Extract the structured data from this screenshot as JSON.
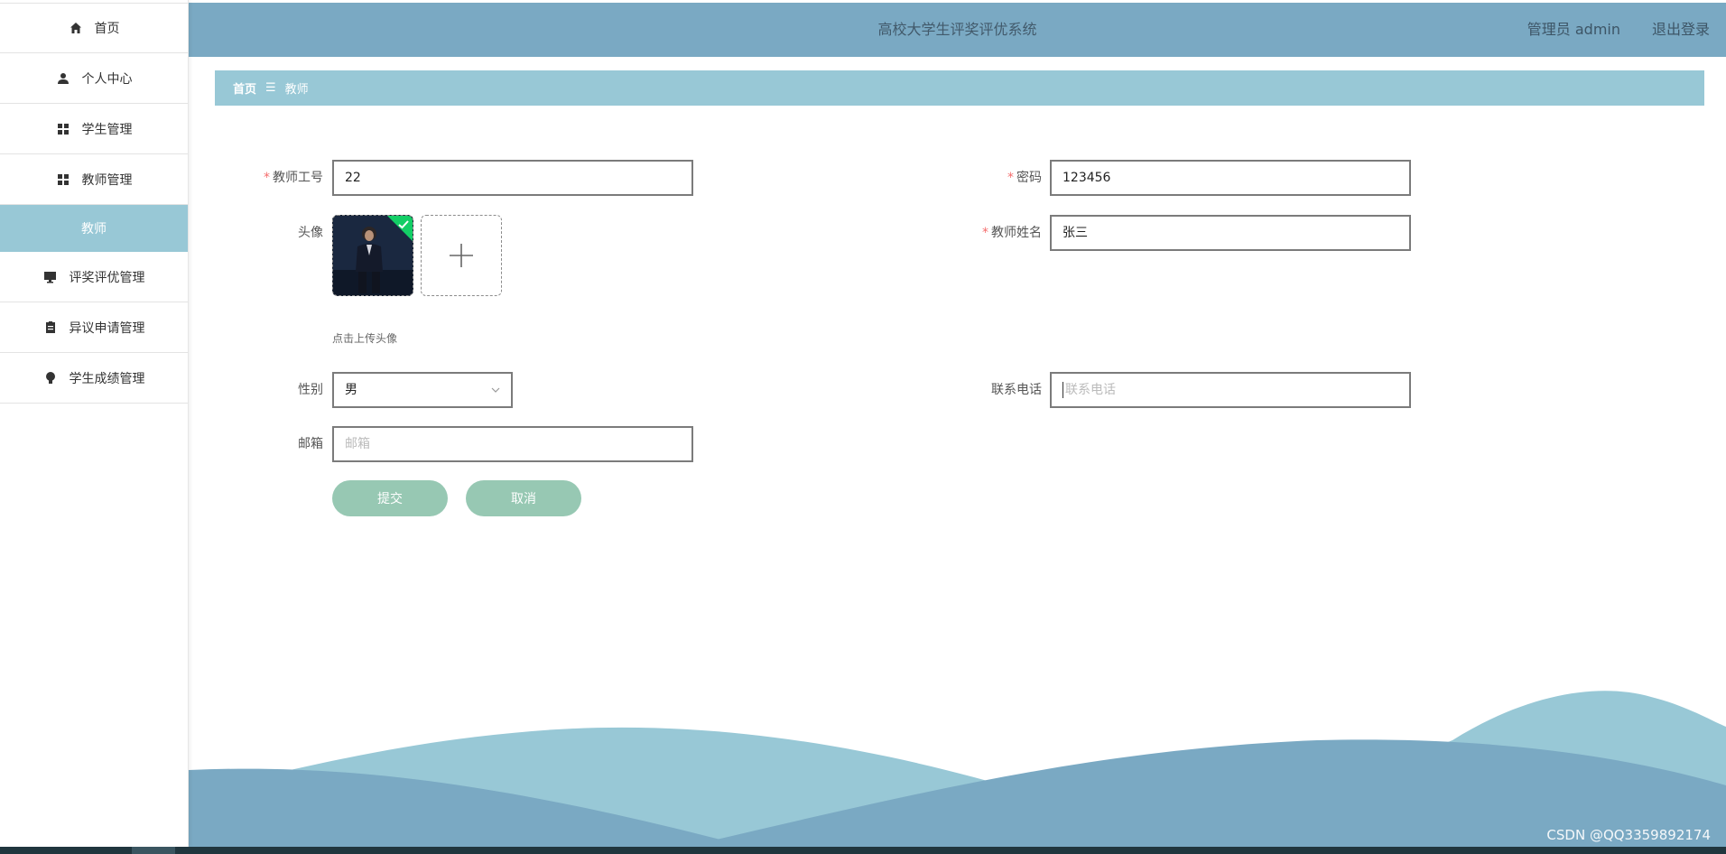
{
  "sidebar": {
    "items": [
      {
        "label": "首页",
        "icon": "home-icon"
      },
      {
        "label": "个人中心",
        "icon": "user-icon"
      },
      {
        "label": "学生管理",
        "icon": "grid-icon"
      },
      {
        "label": "教师管理",
        "icon": "grid-icon"
      },
      {
        "label": "教师",
        "icon": ""
      },
      {
        "label": "评奖评优管理",
        "icon": "monitor-icon"
      },
      {
        "label": "异议申请管理",
        "icon": "clipboard-icon"
      },
      {
        "label": "学生成绩管理",
        "icon": "bulb-icon"
      }
    ]
  },
  "header": {
    "title": "高校大学生评奖评优系统",
    "user": "管理员 admin",
    "logout": "退出登录"
  },
  "breadcrumb": {
    "home": "首页",
    "separator": "☰",
    "current": "教师"
  },
  "form": {
    "teacher_id": {
      "label": "教师工号",
      "required": "*",
      "value": "22"
    },
    "password": {
      "label": "密码",
      "required": "*",
      "value": "123456"
    },
    "avatar": {
      "label": "头像",
      "tip": "点击上传头像"
    },
    "teacher_name": {
      "label": "教师姓名",
      "required": "*",
      "value": "张三"
    },
    "gender": {
      "label": "性别",
      "value": "男"
    },
    "phone": {
      "label": "联系电话",
      "placeholder": "联系电话"
    },
    "email": {
      "label": "邮箱",
      "placeholder": "邮箱"
    },
    "submit": "提交",
    "cancel": "取消"
  },
  "watermark": "CSDN @QQ3359892174",
  "colors": {
    "header": "#7aa9c3",
    "breadcrumb": "#98c8d6",
    "active_menu": "#98c8d6",
    "button": "#97c8b3",
    "required": "#f56c6c",
    "avatar_corner": "#13ce66"
  }
}
